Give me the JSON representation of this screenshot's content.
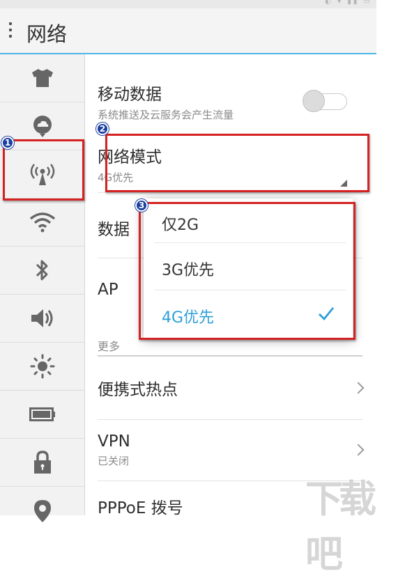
{
  "title_bar": {
    "title": "网络"
  },
  "sidebar": {
    "items": [
      {
        "icon": "theme-shirt-icon"
      },
      {
        "icon": "cloud-service-icon"
      },
      {
        "icon": "mobile-signal-icon",
        "selected": true
      },
      {
        "icon": "wifi-icon"
      },
      {
        "icon": "bluetooth-icon"
      },
      {
        "icon": "volume-icon"
      },
      {
        "icon": "brightness-icon"
      },
      {
        "icon": "battery-icon"
      },
      {
        "icon": "lock-icon"
      },
      {
        "icon": "location-icon"
      }
    ]
  },
  "settings": {
    "mobile_data": {
      "title": "移动数据",
      "subtitle": "系统推送及云服务会产生流量",
      "enabled": false
    },
    "network_mode": {
      "title": "网络模式",
      "value": "4G优先"
    },
    "data_partial": {
      "title": "数据"
    },
    "apn_partial": {
      "title": "AP"
    },
    "more_partial": {
      "title": "更多"
    },
    "hotspot": {
      "title": "便携式热点"
    },
    "vpn": {
      "title": "VPN",
      "subtitle": "已关闭"
    },
    "pppoe": {
      "title": "PPPoE 拨号"
    }
  },
  "network_mode_popup": {
    "options": [
      {
        "label": "仅2G",
        "selected": false
      },
      {
        "label": "3G优先",
        "selected": false
      },
      {
        "label": "4G优先",
        "selected": true
      }
    ]
  },
  "annotations": {
    "badges": [
      "1",
      "2",
      "3"
    ],
    "box_color": "#d42121",
    "badge_color": "#1a3fa0"
  },
  "colors": {
    "accent": "#2e9fd8",
    "title_underline": "#4cb4e6"
  }
}
